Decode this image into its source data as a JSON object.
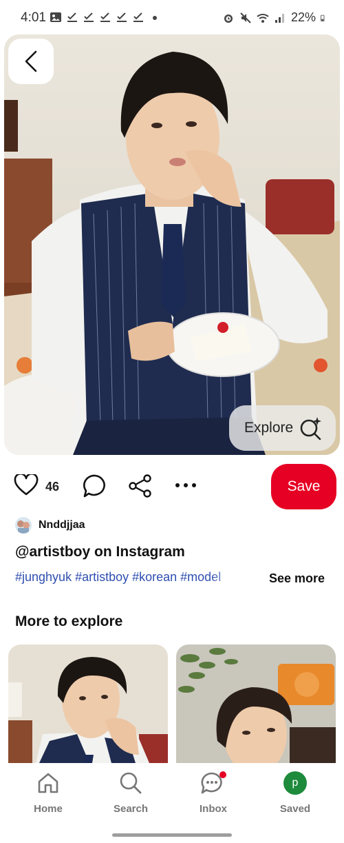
{
  "status_bar": {
    "time": "4:01",
    "battery": "22%",
    "icons": [
      "image-icon",
      "check-icon",
      "check-icon",
      "check-icon",
      "check-icon",
      "check-icon",
      "dot-icon",
      "alarm-icon",
      "mute-icon",
      "wifi-icon",
      "signal-icon",
      "battery-icon"
    ]
  },
  "pin": {
    "explore_label": "Explore",
    "like_count": "46",
    "save_label": "Save",
    "author": "Nnddjjaa",
    "title": "@artistboy on Instagram",
    "hashtags": "#junghyuk #artistboy #korean #model",
    "see_more": "See more"
  },
  "more_to_explore": {
    "title": "More to explore"
  },
  "bottom_nav": {
    "home": "Home",
    "search": "Search",
    "inbox": "Inbox",
    "saved": "Saved",
    "saved_initial": "p"
  },
  "colors": {
    "brand_red": "#e60023",
    "hashtag_blue": "#2f4fb0",
    "saved_avatar": "#1e8a3c"
  }
}
